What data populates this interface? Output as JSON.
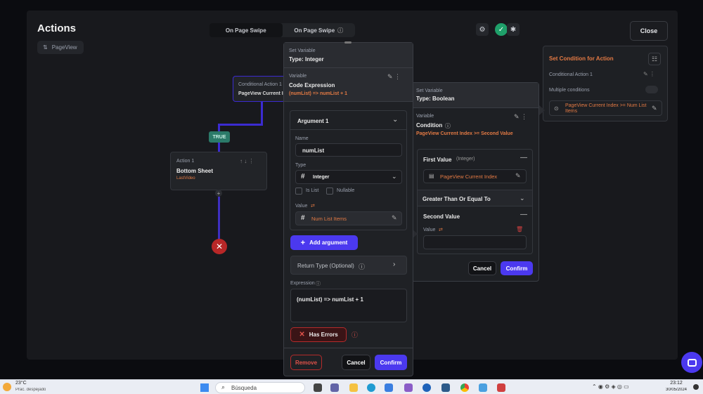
{
  "header": {
    "title": "Actions",
    "page_chip": "PageView",
    "tabs": [
      "On Page Swipe",
      "On Page Swipe"
    ],
    "close_label": "Close"
  },
  "flow": {
    "conditional": {
      "title": "Conditional Action 1",
      "subtitle": "PageView Current Index"
    },
    "true_label": "TRUE",
    "action1": {
      "label": "Action 1",
      "name": "Bottom Sheet",
      "sub": "LastVideo"
    }
  },
  "right_panel": {
    "title": "Set Condition for Action",
    "conditional": "Conditional Action 1",
    "multiple": "Multiple conditions",
    "condition_text": "PageView Current Index  >=  Num List Items"
  },
  "middle": {
    "set_var_label": "Set Variable",
    "set_var_type": "Type: Boolean",
    "variable_label": "Variable",
    "condition_title": "Condition",
    "condition_expr": "PageView Current Index  >=  Second Value",
    "first_value": "First Value",
    "first_value_type": "(Integer)",
    "first_value_field": "PageView Current Index",
    "operator": "Greater Than Or Equal To",
    "second_value": "Second Value",
    "value_label": "Value",
    "cancel": "Cancel",
    "confirm": "Confirm"
  },
  "front": {
    "set_var_label": "Set Variable",
    "set_var_type": "Type: Integer",
    "variable_label": "Variable",
    "code_title": "Code Expression",
    "code_sub": "(numList) => numList + 1",
    "argument_title": "Argument 1",
    "name_label": "Name",
    "name_value": "numList",
    "type_label": "Type",
    "type_value": "Integer",
    "is_list": "Is List",
    "nullable": "Nullable",
    "value_label": "Value",
    "value_field": "Num List Items",
    "add_argument": "Add argument",
    "return_type": "Return Type (Optional)",
    "expression_label": "Expression",
    "expression_value": "(numList) => numList + 1",
    "has_errors": "Has Errors",
    "remove": "Remove",
    "cancel": "Cancel",
    "confirm": "Confirm"
  },
  "taskbar": {
    "temp": "23°C",
    "weather": "Prac. despejado",
    "search": "Búsqueda",
    "time": "23:12",
    "date": "30/05/2024"
  },
  "colors": {
    "accent": "#4b39ef",
    "orange": "#e47a44",
    "success": "#2b7a69",
    "danger": "#b82727"
  }
}
